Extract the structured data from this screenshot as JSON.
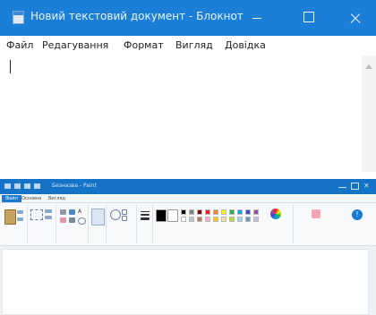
{
  "notepad": {
    "title": "Новий текстовий документ - Блокнот",
    "menu": [
      "Файл",
      "Редагування",
      "Формат",
      "Вигляд",
      "Довідка"
    ],
    "colors": {
      "titlebar": "#1b7fd8"
    }
  },
  "paint": {
    "title": "Безназва - Paint",
    "tabs": [
      "Файл",
      "Основне",
      "Вигляд"
    ],
    "palette": [
      "#000000",
      "#7f7f7f",
      "#880015",
      "#ed1c24",
      "#ff7f27",
      "#fff200",
      "#22b14c",
      "#00a2e8",
      "#3f48cc",
      "#a349a4",
      "#ffffff",
      "#c3c3c3",
      "#b97a57",
      "#ffaec9",
      "#ffc90e",
      "#efe4b0",
      "#b5e61d",
      "#99d9ea",
      "#7092be",
      "#c8bfe7"
    ],
    "icons": [
      "paste-icon",
      "cut-icon",
      "copy-icon",
      "select-icon",
      "crop-icon",
      "pencil-icon",
      "fill-icon",
      "text-icon",
      "eraser-icon",
      "color-picker-icon",
      "magnifier-icon",
      "brush-icon",
      "shapes-icon",
      "size-icon",
      "color1-icon",
      "color2-icon",
      "edit-colors-icon",
      "paint3d-icon",
      "alert-icon"
    ],
    "colors": {
      "titlebar": "#1573c7",
      "active_tab": "#1a79d1"
    }
  }
}
